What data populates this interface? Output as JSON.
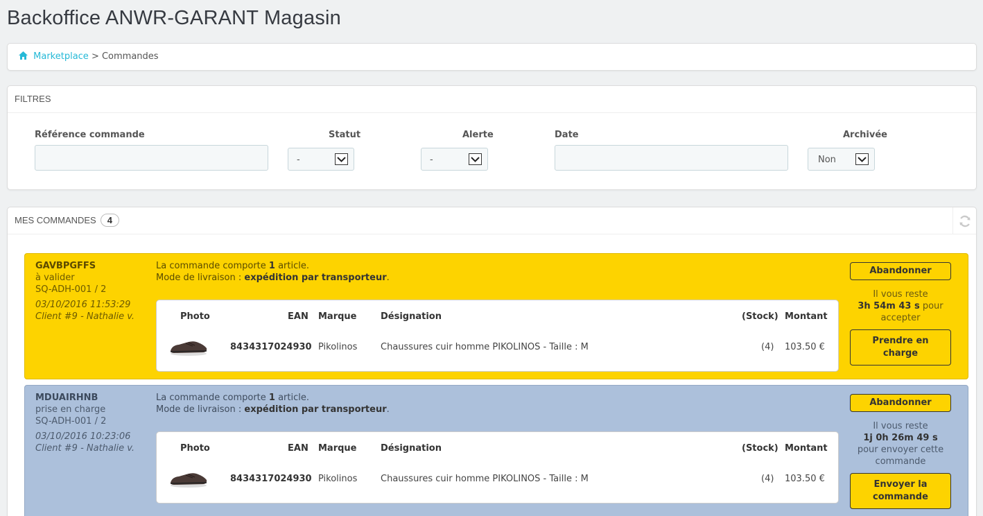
{
  "page": {
    "title": "Backoffice ANWR-GARANT Magasin"
  },
  "breadcrumb": {
    "link": "Marketplace",
    "separator": " > ",
    "current": "Commandes"
  },
  "filters": {
    "heading": "FILTRES",
    "reference_label": "Référence commande",
    "statut_label": "Statut",
    "statut_value": "-",
    "alerte_label": "Alerte",
    "alerte_value": "-",
    "date_label": "Date",
    "archivee_label": "Archivée",
    "archivee_value": "Non"
  },
  "orders_panel": {
    "heading": "MES COMMANDES",
    "count": "4"
  },
  "table_headers": {
    "photo": "Photo",
    "ean": "EAN",
    "marque": "Marque",
    "designation": "Désignation",
    "stock": "(Stock)",
    "montant": "Montant"
  },
  "orders": [
    {
      "ref": "GAVBPGFFS",
      "status": "à valider",
      "code": "SQ-ADH-001 / 2",
      "date": "03/10/2016 11:53:29",
      "client": "Client #9 - Nathalie v.",
      "info_prefix": "La commande comporte ",
      "info_count": "1",
      "info_suffix": " article.",
      "delivery_prefix": "Mode de livraison : ",
      "delivery_mode": "expédition par transporteur",
      "delivery_suffix": ".",
      "item": {
        "ean": "8434317024930",
        "marque": "Pikolinos",
        "designation": "Chaussures cuir homme PIKOLINOS - Taille : M",
        "stock": "(4)",
        "montant": "103.50 €"
      },
      "btn_abandon": "Abandonner",
      "remain_prefix": "Il vous reste",
      "remain_time": "3h 54m 43 s",
      "remain_suffix": " pour accepter",
      "btn_action_line1": "Prendre en",
      "btn_action_line2": "charge"
    },
    {
      "ref": "MDUAIRHNB",
      "status": "prise en charge",
      "code": "SQ-ADH-001 / 2",
      "date": "03/10/2016 10:23:06",
      "client": "Client #9 - Nathalie v.",
      "info_prefix": "La commande comporte ",
      "info_count": "1",
      "info_suffix": " article.",
      "delivery_prefix": "Mode de livraison : ",
      "delivery_mode": "expédition par transporteur",
      "delivery_suffix": ".",
      "item": {
        "ean": "8434317024930",
        "marque": "Pikolinos",
        "designation": "Chaussures cuir homme PIKOLINOS - Taille : M",
        "stock": "(4)",
        "montant": "103.50 €"
      },
      "btn_abandon": "Abandonner",
      "remain_prefix": "Il vous reste",
      "remain_time": "1j 0h 26m 49 s",
      "remain_suffix": "pour envoyer cette commande",
      "btn_action_line1": "Envoyer la",
      "btn_action_line2": "commande"
    }
  ],
  "colors": {
    "link": "#25b9d7",
    "order_yellow": "#fdd300",
    "order_blue": "#acc0db",
    "button": "#fdd300"
  }
}
